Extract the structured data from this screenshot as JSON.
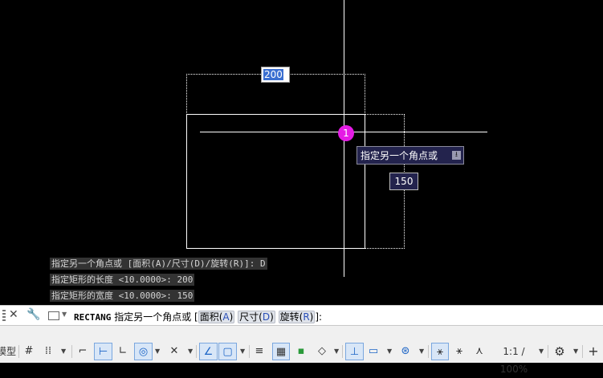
{
  "drawing": {
    "length_input": "200",
    "width_input": "150",
    "marker_number": "1",
    "tooltip": "指定另一个角点或",
    "tooltip_down_icon": "download-arrow-icon"
  },
  "history": [
    "指定另一个角点或 [面积(A)/尺寸(D)/旋转(R)]: D",
    "指定矩形的长度 <10.0000>: 200",
    "指定矩形的宽度 <10.0000>: 150"
  ],
  "command": {
    "cmd": "RECTANG",
    "prompt": "指定另一个角点或",
    "open_bracket": "[",
    "options": [
      {
        "label": "面积",
        "key": "A"
      },
      {
        "label": "尺寸",
        "key": "D"
      },
      {
        "label": "旋转",
        "key": "R"
      }
    ],
    "close": "]:"
  },
  "status": {
    "model_tab": "模型",
    "scale_label": "1:1 / 100%"
  },
  "colors": {
    "canvas": "#000000",
    "marker": "#e51be5",
    "tooltip_bg": "#23234d",
    "input_highlight": "#3b6fd1",
    "active_icon": "#1b64c6"
  }
}
